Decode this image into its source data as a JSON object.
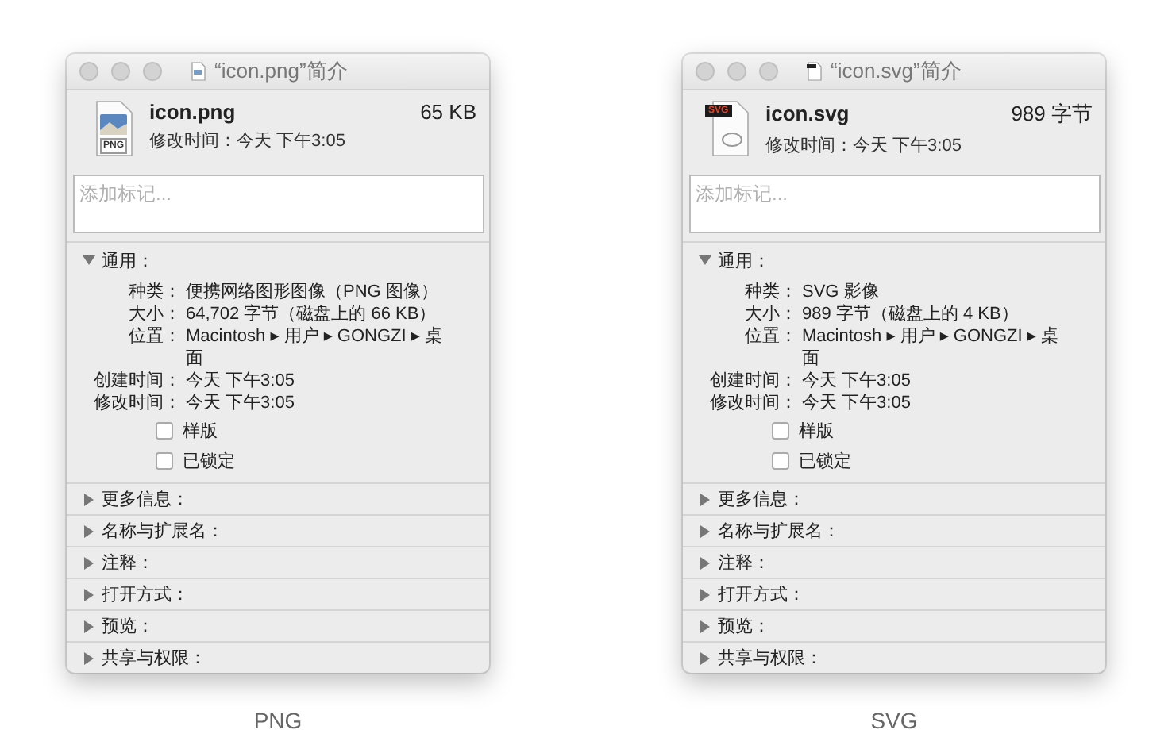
{
  "windows": [
    {
      "title": "“icon.png”简介",
      "kind": "png",
      "icon_label": "PNG",
      "name": "icon.png",
      "size": "65 KB",
      "modified": "修改时间：今天 下午3:05",
      "tags_placeholder": "添加标记...",
      "general": {
        "label": "通用：",
        "expanded": true,
        "fields": [
          {
            "label": "种类：",
            "value": "便携网络图形图像（PNG 图像）"
          },
          {
            "label": "大小：",
            "value": "64,702 字节（磁盘上的 66 KB）"
          },
          {
            "label": "位置：",
            "value": "Macintosh ▸ 用户 ▸ GONGZI ▸ 桌面"
          },
          {
            "label": "创建时间：",
            "value": "今天 下午3:05"
          },
          {
            "label": "修改时间：",
            "value": "今天 下午3:05"
          }
        ],
        "checkboxes": [
          {
            "label": "样版",
            "checked": false
          },
          {
            "label": "已锁定",
            "checked": false
          }
        ]
      },
      "sections": [
        {
          "label": "更多信息：",
          "expanded": false
        },
        {
          "label": "名称与扩展名：",
          "expanded": false
        },
        {
          "label": "注释：",
          "expanded": false
        },
        {
          "label": "打开方式：",
          "expanded": false
        },
        {
          "label": "预览：",
          "expanded": false
        },
        {
          "label": "共享与权限：",
          "expanded": false
        }
      ],
      "caption": "PNG"
    },
    {
      "title": "“icon.svg”简介",
      "kind": "svg",
      "icon_label": "SVG",
      "name": "icon.svg",
      "size": "989 字节",
      "modified": "修改时间：今天 下午3:05",
      "tags_placeholder": "添加标记...",
      "general": {
        "label": "通用：",
        "expanded": true,
        "fields": [
          {
            "label": "种类：",
            "value": "SVG 影像"
          },
          {
            "label": "大小：",
            "value": "989 字节（磁盘上的 4 KB）"
          },
          {
            "label": "位置：",
            "value": "Macintosh ▸ 用户 ▸ GONGZI ▸ 桌面"
          },
          {
            "label": "创建时间：",
            "value": "今天 下午3:05"
          },
          {
            "label": "修改时间：",
            "value": "今天 下午3:05"
          }
        ],
        "checkboxes": [
          {
            "label": "样版",
            "checked": false
          },
          {
            "label": "已锁定",
            "checked": false
          }
        ]
      },
      "sections": [
        {
          "label": "更多信息：",
          "expanded": false
        },
        {
          "label": "名称与扩展名：",
          "expanded": false
        },
        {
          "label": "注释：",
          "expanded": false
        },
        {
          "label": "打开方式：",
          "expanded": false
        },
        {
          "label": "预览：",
          "expanded": false
        },
        {
          "label": "共享与权限：",
          "expanded": false
        }
      ],
      "caption": "SVG"
    }
  ]
}
